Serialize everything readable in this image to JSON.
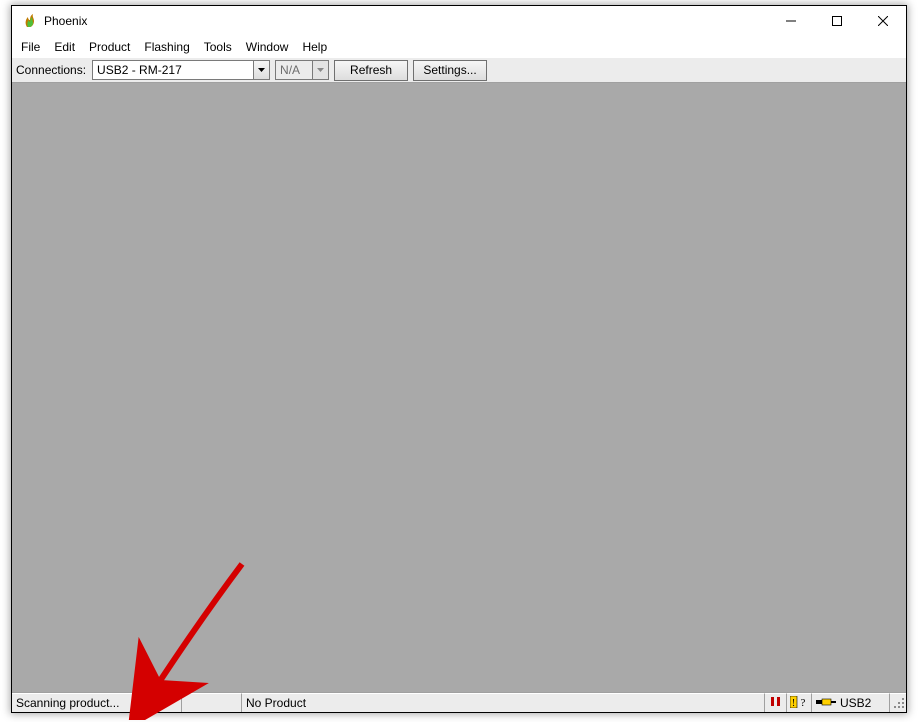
{
  "window": {
    "title": "Phoenix"
  },
  "menu": {
    "items": [
      "File",
      "Edit",
      "Product",
      "Flashing",
      "Tools",
      "Window",
      "Help"
    ]
  },
  "toolbar": {
    "connections_label": "Connections:",
    "connection_value": "USB2 - RM-217",
    "secondary_value": "N/A",
    "refresh_label": "Refresh",
    "settings_label": "Settings..."
  },
  "status": {
    "scan_text": "Scanning product...",
    "product_text": "No Product",
    "conn_text": "USB2"
  }
}
